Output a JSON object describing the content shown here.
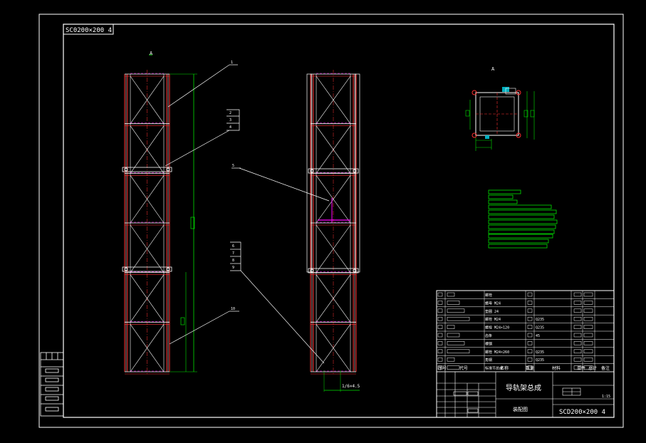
{
  "drawing": {
    "stamp": "SC0200×200 4",
    "callouts": [
      "1",
      "2",
      "3",
      "4",
      "5",
      "6",
      "7",
      "8",
      "9",
      "10"
    ],
    "section_label": "A",
    "dimension_note": "1/6×4.5",
    "title_block": {
      "title": "导轨架总成",
      "subtitle": "装配图",
      "drawing_no": "SCD200×200 4",
      "scale": "1:15",
      "header_row": [
        "序号",
        "代号",
        "名称",
        "数量",
        "材料",
        "单件",
        "总计",
        "备注"
      ],
      "parts": [
        {
          "no": "11",
          "code": "",
          "name": "螺栓",
          "qty": "",
          "material": ""
        },
        {
          "no": "10",
          "code": "",
          "name": "螺母 M24",
          "qty": "",
          "material": ""
        },
        {
          "no": "9",
          "code": "",
          "name": "垫圈 24",
          "qty": "",
          "material": ""
        },
        {
          "no": "8",
          "code": "",
          "name": "螺栓 M24",
          "qty": "",
          "material": "Q235"
        },
        {
          "no": "7",
          "code": "",
          "name": "螺栓 M24×120",
          "qty": "",
          "material": "Q235"
        },
        {
          "no": "6",
          "code": "",
          "name": "齿条",
          "qty": "",
          "material": "45"
        },
        {
          "no": "5",
          "code": "",
          "name": "槽钢",
          "qty": "",
          "material": ""
        },
        {
          "no": "4",
          "code": "",
          "name": "螺栓 M24×260",
          "qty": "",
          "material": "Q235"
        },
        {
          "no": "3",
          "code": "",
          "name": "角钢",
          "qty": "",
          "material": "Q235"
        },
        {
          "no": "2",
          "code": "",
          "name": "标准节总成",
          "qty": "",
          "material": ""
        }
      ]
    },
    "colors": {
      "frame": "#ffffff",
      "steel": "#ff3030",
      "brace": "#ffffff",
      "dim": "#00e000",
      "center": "#ff00ff",
      "note": "#00e0e0"
    }
  }
}
